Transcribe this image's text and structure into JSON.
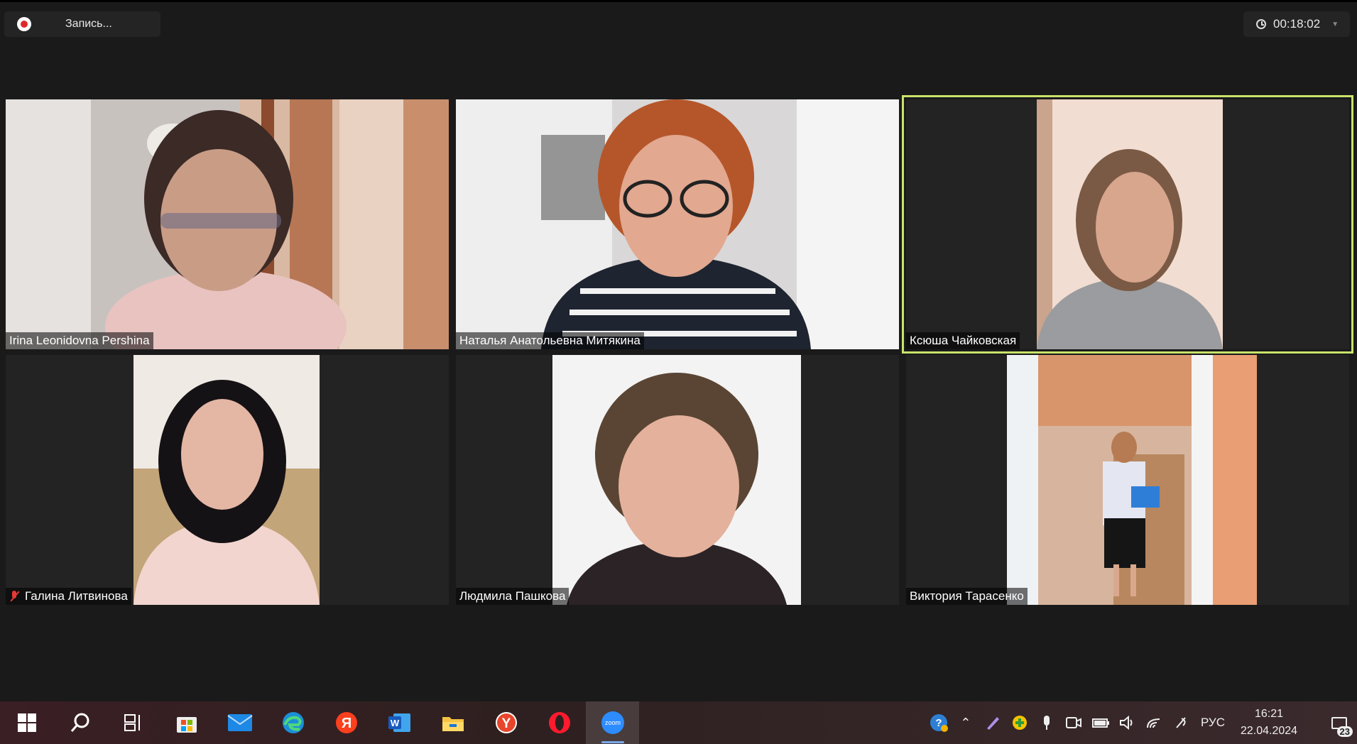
{
  "recording": {
    "label": "Запись..."
  },
  "timer": {
    "elapsed": "00:18:02"
  },
  "participants": [
    {
      "name": "Irina Leonidovna Pershina",
      "muted": false,
      "speaking": false
    },
    {
      "name": "Наталья Анатольевна Митякина",
      "muted": false,
      "speaking": false
    },
    {
      "name": "Ксюша Чайковская",
      "muted": false,
      "speaking": true
    },
    {
      "name": "Галина Литвинова",
      "muted": true,
      "speaking": false
    },
    {
      "name": "Людмила Пашкова",
      "muted": false,
      "speaking": false
    },
    {
      "name": "Виктория Тарасенко",
      "muted": false,
      "speaking": false
    }
  ],
  "taskbar": {
    "apps": [
      {
        "icon": "windows-start-icon"
      },
      {
        "icon": "search-icon"
      },
      {
        "icon": "task-view-icon"
      },
      {
        "icon": "microsoft-store-icon"
      },
      {
        "icon": "mail-icon"
      },
      {
        "icon": "edge-icon"
      },
      {
        "icon": "yandex-icon",
        "label": "Я"
      },
      {
        "icon": "word-icon",
        "label": "W"
      },
      {
        "icon": "file-explorer-icon"
      },
      {
        "icon": "yandex-browser-icon",
        "label": "Y"
      },
      {
        "icon": "opera-icon",
        "label": "O"
      },
      {
        "icon": "zoom-icon",
        "label": "zoom",
        "active": true
      }
    ],
    "language": "РУС",
    "time": "16:21",
    "date": "22.04.2024",
    "notifications": "23"
  },
  "colors": {
    "speaking_border": "#c9e36a",
    "record_dot": "#e02828",
    "muted_mic": "#e53935",
    "zoom_blue": "#2d8cff"
  }
}
